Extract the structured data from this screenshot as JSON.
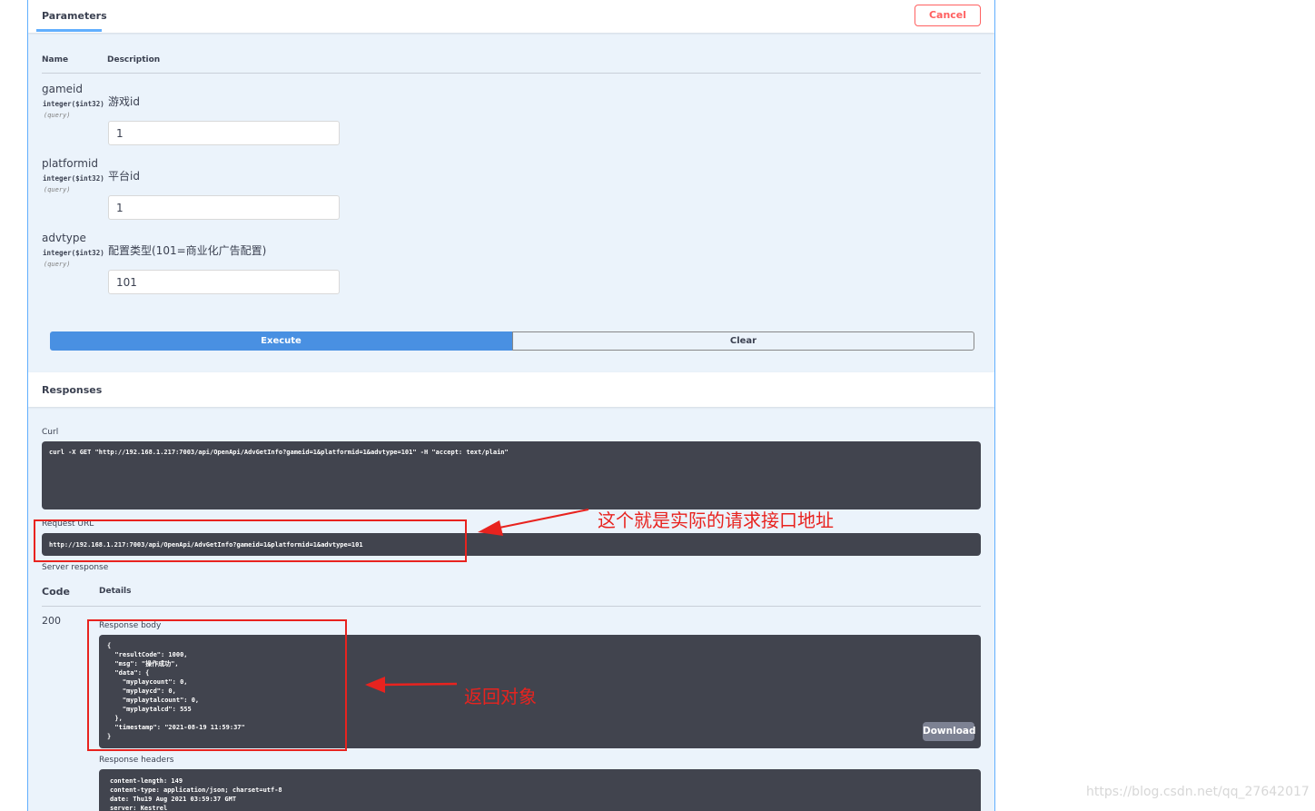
{
  "parameters": {
    "tab_label": "Parameters",
    "cancel_label": "Cancel",
    "col_name": "Name",
    "col_description": "Description",
    "items": [
      {
        "name": "gameid",
        "type": "integer($int32)",
        "in": "(query)",
        "description": "游戏id",
        "value": "1"
      },
      {
        "name": "platformid",
        "type": "integer($int32)",
        "in": "(query)",
        "description": "平台id",
        "value": "1"
      },
      {
        "name": "advtype",
        "type": "integer($int32)",
        "in": "(query)",
        "description": "配置类型(101=商业化广告配置)",
        "value": "101"
      }
    ],
    "execute_label": "Execute",
    "clear_label": "Clear"
  },
  "responses": {
    "title": "Responses",
    "curl_label": "Curl",
    "curl_command": "curl -X GET \"http://192.168.1.217:7003/api/OpenApi/AdvGetInfo?gameid=1&platformid=1&advtype=101\" -H \"accept: text/plain\"",
    "request_url_label": "Request URL",
    "request_url": "http://192.168.1.217:7003/api/OpenApi/AdvGetInfo?gameid=1&platformid=1&advtype=101",
    "server_response_label": "Server response",
    "col_code": "Code",
    "col_details": "Details",
    "status_code": "200",
    "response_body_label": "Response body",
    "response_body": "{\n  \"resultCode\": 1000,\n  \"msg\": \"操作成功\",\n  \"data\": {\n    \"myplaycount\": 0,\n    \"myplaycd\": 0,\n    \"myplaytalcount\": 0,\n    \"myplaytalcd\": 555\n  },\n  \"timestamp\": \"2021-08-19 11:59:37\"\n}",
    "download_label": "Download",
    "response_headers_label": "Response headers",
    "response_headers": "content-length: 149\ncontent-type: application/json; charset=utf-8\ndate: Thu19 Aug 2021 03:59:37 GMT\nserver: Kestrel"
  },
  "annotations": {
    "request_url_note": "这个就是实际的请求接口地址",
    "response_body_note": "返回对象",
    "color": "#e8231f"
  },
  "watermark": "https://blog.csdn.net/qq_27642017"
}
